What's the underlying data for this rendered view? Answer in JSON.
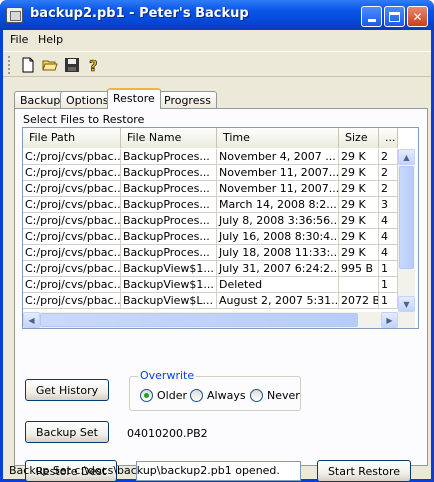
{
  "window": {
    "title": "backup2.pb1 - Peter's Backup"
  },
  "menu": {
    "file": "File",
    "help": "Help"
  },
  "toolbar": {
    "icons": [
      "new-file-icon",
      "open-folder-icon",
      "save-disk-icon",
      "help-question-icon"
    ]
  },
  "tabs": [
    {
      "label": "Backup"
    },
    {
      "label": "Options"
    },
    {
      "label": "Restore"
    },
    {
      "label": "Progress"
    }
  ],
  "active_tab": "Restore",
  "restore": {
    "section_label": "Select Files to Restore",
    "columns": [
      "File Path",
      "File Name",
      "Time",
      "Size",
      "..."
    ],
    "rows": [
      {
        "path": "C:/proj/cvs/pbac...",
        "name": "BackupProces...",
        "time": "November 4, 2007 ...",
        "size": "29 K",
        "extra": "2"
      },
      {
        "path": "C:/proj/cvs/pbac...",
        "name": "BackupProces...",
        "time": "November 11, 2007...",
        "size": "29 K",
        "extra": "2"
      },
      {
        "path": "C:/proj/cvs/pbac...",
        "name": "BackupProces...",
        "time": "November 11, 2007...",
        "size": "29 K",
        "extra": "2"
      },
      {
        "path": "C:/proj/cvs/pbac...",
        "name": "BackupProces...",
        "time": "March 14, 2008 8:2...",
        "size": "29 K",
        "extra": "3"
      },
      {
        "path": "C:/proj/cvs/pbac...",
        "name": "BackupProces...",
        "time": "July 8, 2008 3:36:56...",
        "size": "29 K",
        "extra": "4"
      },
      {
        "path": "C:/proj/cvs/pbac...",
        "name": "BackupProces...",
        "time": "July 16, 2008 8:30:4...",
        "size": "29 K",
        "extra": "4"
      },
      {
        "path": "C:/proj/cvs/pbac...",
        "name": "BackupProces...",
        "time": "July 18, 2008 11:33:...",
        "size": "29 K",
        "extra": "4"
      },
      {
        "path": "C:/proj/cvs/pbac...",
        "name": "BackupView$1...",
        "time": "July 31, 2007 6:24:2...",
        "size": "995 B",
        "extra": "1"
      },
      {
        "path": "C:/proj/cvs/pbac...",
        "name": "BackupView$1...",
        "time": "Deleted",
        "size": "",
        "extra": "1"
      },
      {
        "path": "C:/proj/cvs/pbac...",
        "name": "BackupView$L...",
        "time": "August 2, 2007 5:31...",
        "size": "2072 B",
        "extra": "1"
      }
    ],
    "buttons": {
      "get_history": "Get History",
      "backup_set": "Backup Set",
      "restore_dest": "Restore Dest",
      "start_restore": "Start Restore"
    },
    "overwrite": {
      "title": "Overwrite",
      "options": [
        "Older",
        "Always",
        "Never"
      ],
      "selected": "Older"
    },
    "backup_set_value": "04010200.PB2",
    "restore_dest_value": ""
  },
  "status": "Backup Set c:\\docs\\backup\\backup2.pb1 opened."
}
